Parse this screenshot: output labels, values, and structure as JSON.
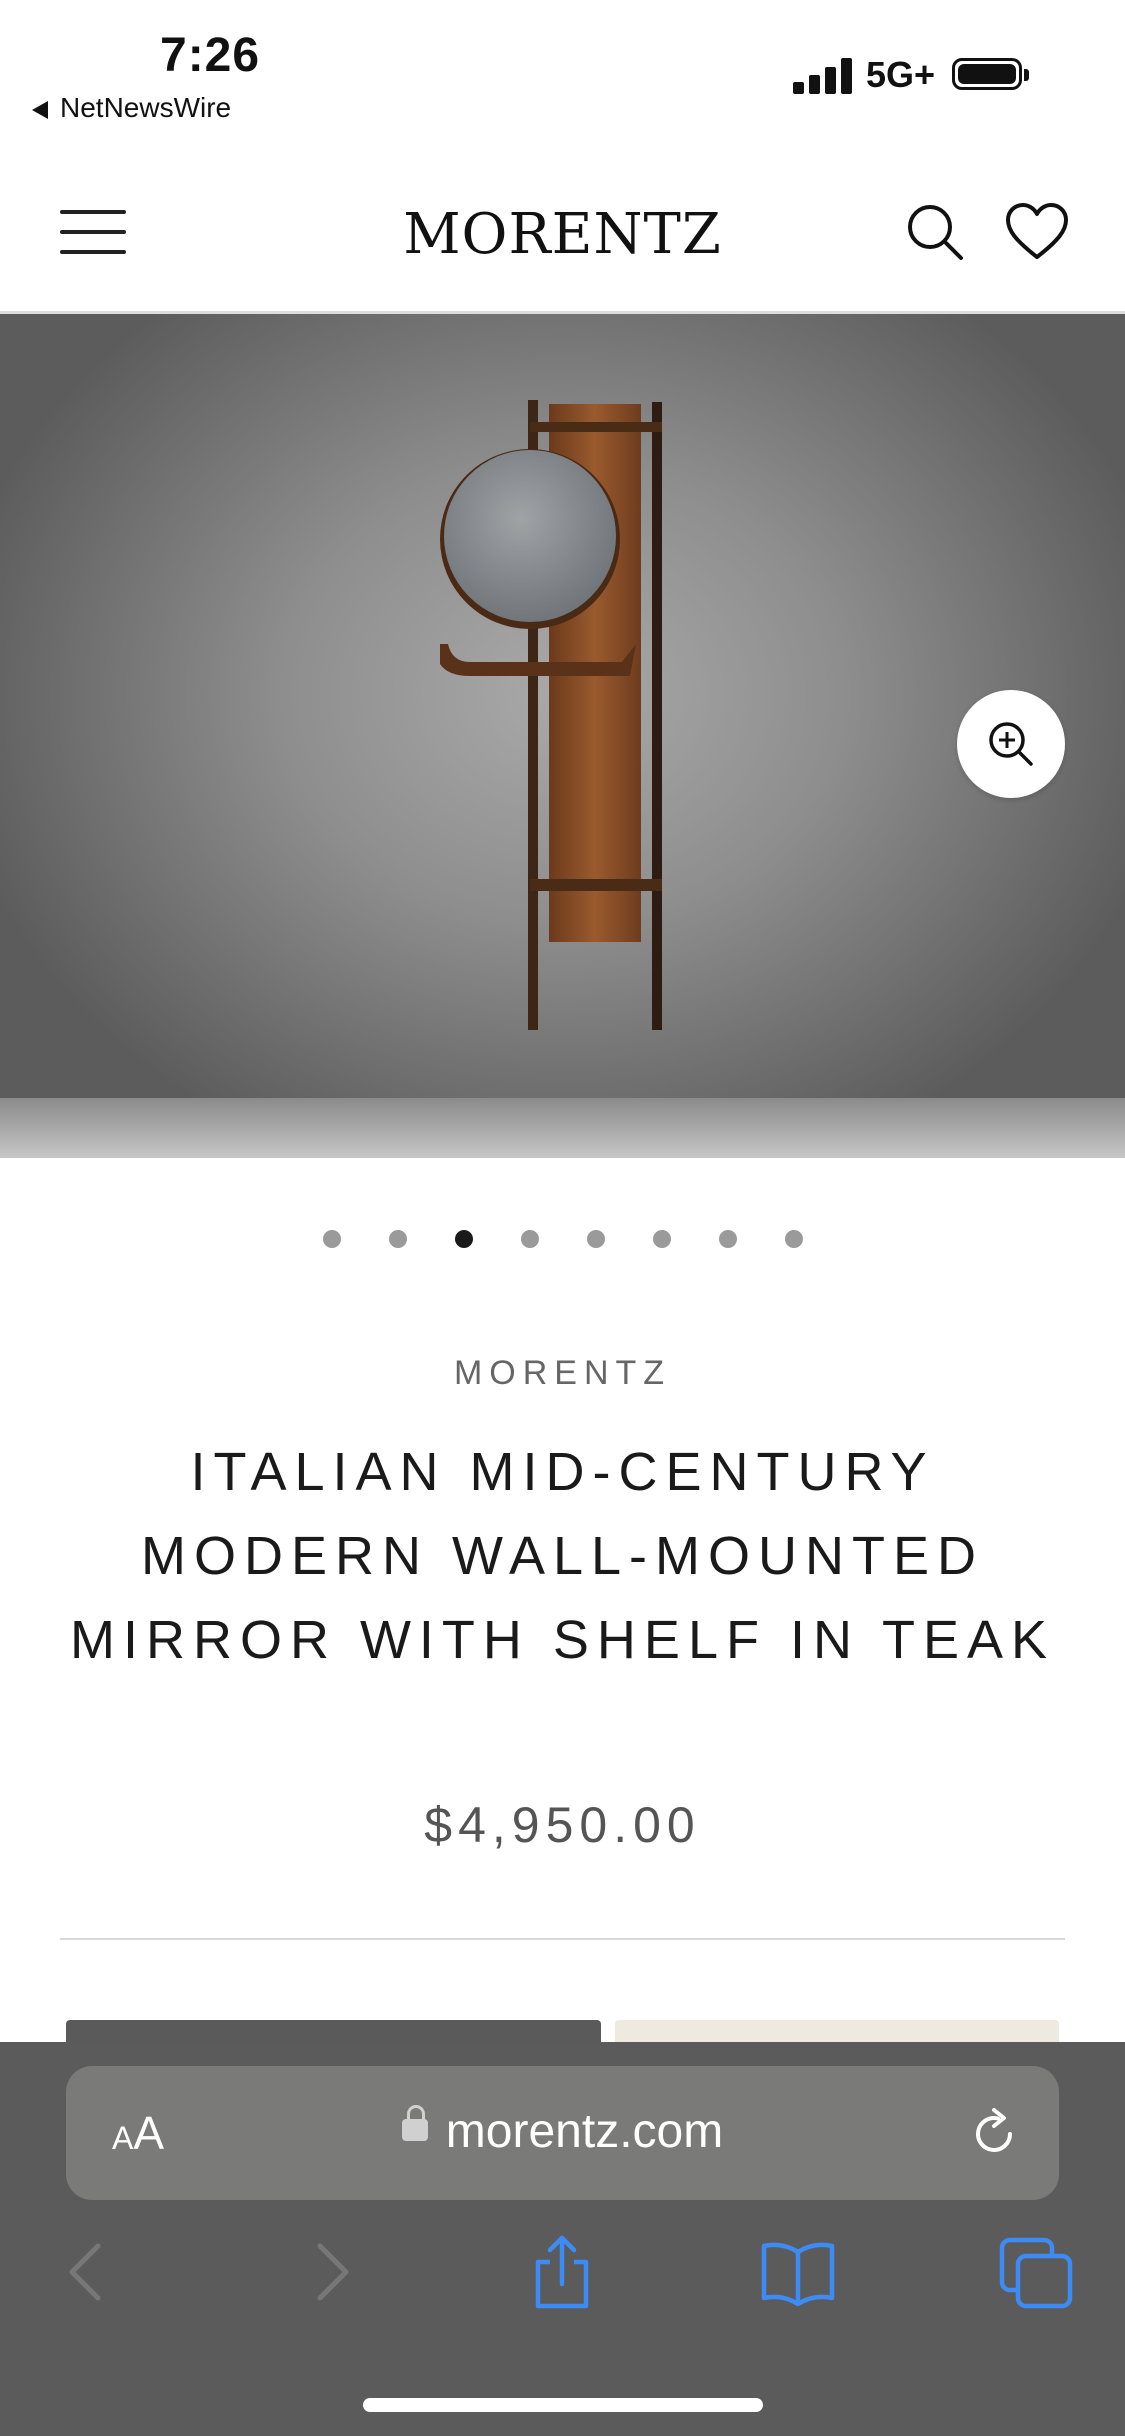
{
  "status_bar": {
    "time": "7:26",
    "back_app": "NetNewsWire",
    "network": "5G+"
  },
  "header": {
    "menu_icon": "hamburger-menu-icon",
    "brand": "MORENTZ",
    "search_icon": "search-icon",
    "wishlist_icon": "heart-icon"
  },
  "hero": {
    "image_description_icon": "product-image",
    "zoom_icon": "zoom-in-icon"
  },
  "carousel": {
    "total": 8,
    "active_index": 2
  },
  "product": {
    "brand": "MORENTZ",
    "title": "ITALIAN MID-CENTURY MODERN WALL-MOUNTED MIRROR WITH SHELF IN TEAK",
    "price": "$4,950.00"
  },
  "browser": {
    "text_size_label_small": "A",
    "text_size_label_large": "A",
    "url": "morentz.com",
    "accent_color": "#3d8cf5"
  }
}
